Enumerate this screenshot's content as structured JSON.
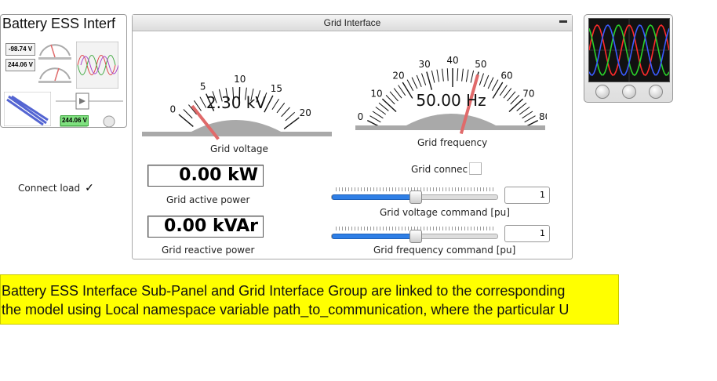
{
  "battery_panel": {
    "title": "Battery ESS Interf",
    "mini_readings": [
      "-98.74 V",
      "244.06 V",
      "244.06 V"
    ]
  },
  "connect_load": {
    "label": "Connect load",
    "checked": true,
    "mark": "✓"
  },
  "grid_interface": {
    "title": "Grid Interface",
    "minimize_glyph": "▬",
    "voltage_gauge": {
      "label": "Grid voltage",
      "readout": "2.30 kV",
      "ticks": [
        "0",
        "5",
        "10",
        "15",
        "20"
      ],
      "value": 2.3,
      "min": 0,
      "max": 20,
      "needle_color": "#e06a6a"
    },
    "frequency_gauge": {
      "label": "Grid frequency",
      "readout": "50.00 Hz",
      "ticks": [
        "0",
        "10",
        "20",
        "30",
        "40",
        "50",
        "60",
        "70",
        "80"
      ],
      "value": 50,
      "min": 0,
      "max": 80,
      "needle_color": "#e06a6a"
    },
    "active_power": {
      "value": "0.00 kW",
      "label": "Grid active power"
    },
    "reactive_power": {
      "value": "0.00 kVAr",
      "label": "Grid reactive power"
    },
    "grid_connect": {
      "label": "Grid connec",
      "checked": false
    },
    "voltage_command": {
      "label": "Grid voltage command [pu]",
      "value": "1",
      "slider_fraction": 0.5
    },
    "frequency_command": {
      "label": "Grid frequency command [pu]",
      "value": "1",
      "slider_fraction": 0.5
    }
  },
  "scope": {
    "trace_colors": [
      "#ff2a2a",
      "#2ad12a",
      "#3a5bff"
    ]
  },
  "note": {
    "line1": "Battery ESS Interface Sub-Panel and Grid Interface Group are linked to the corresponding",
    "line2": "the model using Local namespace variable path_to_communication, where the particular U"
  },
  "colors": {
    "accent": "#2f7fe6",
    "note_bg": "#ffff00",
    "gauge_base": "#a9a9a9"
  }
}
